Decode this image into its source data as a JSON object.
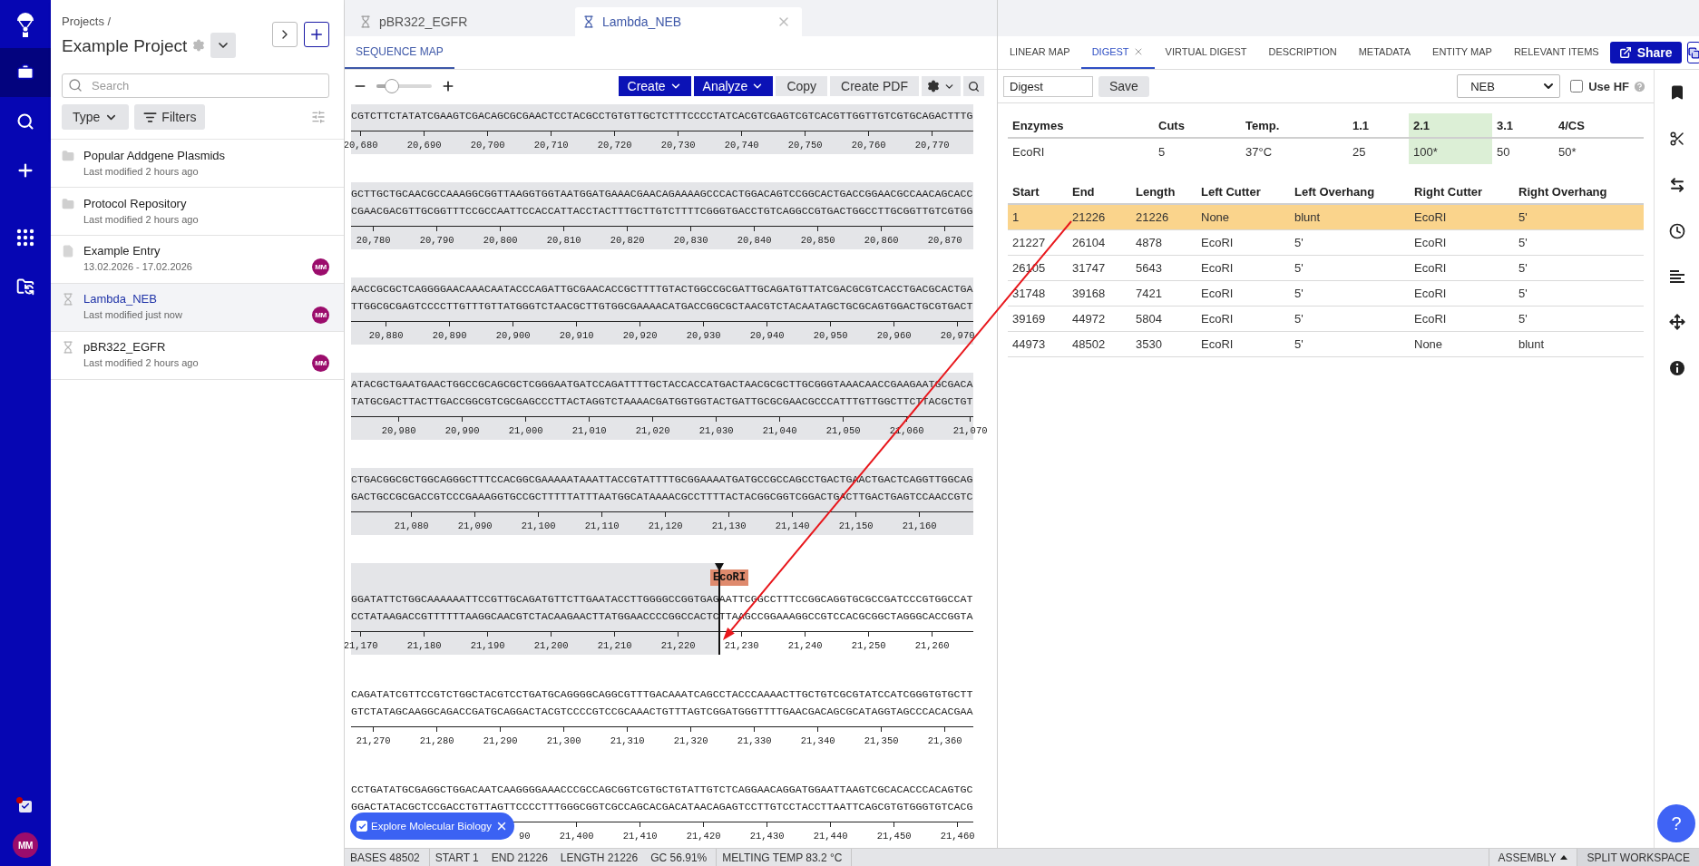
{
  "rail": {
    "items": [
      {
        "selected": true
      },
      {
        "selected": false
      },
      {
        "selected": false
      },
      {
        "selected": false
      },
      {
        "selected": false
      }
    ],
    "tasks": {
      "notification": true
    },
    "avatar": "MM"
  },
  "project_panel": {
    "breadcrumb": "Projects /",
    "title": "Example Project",
    "search": {
      "placeholder": "Search"
    },
    "type_button": "Type",
    "filters_button": "Filters",
    "items": [
      {
        "kind": "folder",
        "title": "Popular Addgene Plasmids",
        "subtitle": "Last modified 2 hours ago",
        "selected": false
      },
      {
        "kind": "folder",
        "title": "Protocol Repository",
        "subtitle": "Last modified 2 hours ago",
        "selected": false
      },
      {
        "kind": "entry",
        "title": "Example Entry",
        "subtitle": "13.02.2026 - 17.02.2026",
        "avatar": "MM",
        "selected": false
      },
      {
        "kind": "sequence",
        "title": "Lambda_NEB",
        "subtitle": "Last modified just now",
        "avatar": "MM",
        "selected": true
      },
      {
        "kind": "sequence",
        "title": "pBR322_EGFR",
        "subtitle": "Last modified 2 hours ago",
        "avatar": "MM",
        "selected": false
      }
    ]
  },
  "editor_tabs": [
    {
      "label": "pBR322_EGFR",
      "selected": false
    },
    {
      "label": "Lambda_NEB",
      "selected": true
    }
  ],
  "sequence_view": {
    "tabs": [
      {
        "label": "SEQUENCE MAP",
        "selected": true
      }
    ],
    "zoom": {
      "level": 0.28
    },
    "toolbar": [
      {
        "kind": "menu",
        "label": "Create"
      },
      {
        "kind": "menu",
        "label": "Analyze"
      },
      {
        "kind": "plain",
        "label": "Copy"
      },
      {
        "kind": "plain",
        "label": "Create PDF"
      },
      {
        "kind": "settings"
      },
      {
        "kind": "search"
      }
    ],
    "blocks": [
      {
        "strands": [
          "CGTCTTCTATATCGAAGTCGACAGCGCGAACTCCTACGCCTGTGTTGCTCTTTCCCCTATCACGTCGAGTCGTCACGTTGGTTGTCGTGCAGACTTTG"
        ],
        "ticks": [
          "20,680",
          "20,690",
          "20,700",
          "20,710",
          "20,720",
          "20,730",
          "20,740",
          "20,750",
          "20,760",
          "20,770"
        ],
        "selected": true
      },
      {
        "strands": [
          "GCTTGCTGCAACGCCAAAGGCGGTTAAGGTGGTAATGGATGAAACGAACAGAAAAGCCCACTGGACAGTCCGGCACTGACCGGAACGCCAACAGCACC",
          "CGAACGACGTTGCGGTTTCCGCCAATTCCACCATTACCTACTTTGCTTGTCTTTTCGGGTGACCTGTCAGGCCGTGACTGGCCTTGCGGTTGTCGTGG"
        ],
        "ticks": [
          "20,780",
          "20,790",
          "20,800",
          "20,810",
          "20,820",
          "20,830",
          "20,840",
          "20,850",
          "20,860",
          "20,870"
        ],
        "selected": true
      },
      {
        "strands": [
          "AACCGCGCTCAGGGGAACAAACAATACCCAGATTGCGAACACCGCTTTTGTACTGGCCGCGATTGCAGATGTTATCGACGCGTCACCTGACGCACTGA",
          "TTGGCGCGAGTCCCCTTGTTTGTTATGGGTCTAACGCTTGTGGCGAAAACATGACCGGCGCTAACGTCTACAATAGCTGCGCAGTGGACTGCGTGACT"
        ],
        "ticks": [
          "20,880",
          "20,890",
          "20,900",
          "20,910",
          "20,920",
          "20,930",
          "20,940",
          "20,950",
          "20,960",
          "20,970"
        ],
        "selected": true
      },
      {
        "strands": [
          "ATACGCTGAATGAACTGGCCGCAGCGCTCGGGAATGATCCAGATTTTGCTACCACCATGACTAACGCGCTTGCGGGTAAACAACCGAAGAATGCGACA",
          "TATGCGACTTACTTGACCGGCGTCGCGAGCCCTTACTAGGTCTAAAACGATGGTGGTACTGATTGCGCGAACGCCCATTTGTTGGCTTCTTACGCTGT"
        ],
        "ticks": [
          "20,980",
          "20,990",
          "21,000",
          "21,010",
          "21,020",
          "21,030",
          "21,040",
          "21,050",
          "21,060",
          "21,070"
        ],
        "selected": true
      },
      {
        "strands": [
          "CTGACGGCGCTGGCAGGGCTTTCCACGGCGAAAAATAAATTACCGTATTTTGCGGAAAATGATGCCGCCAGCCTGACTGAACTGACTCAGGTTGGCAG",
          "GACTGCCGCGACCGTCCCGAAAGGTGCCGCTTTTTATTTAATGGCATAAAACGCCTTTTACTACGGCGGTCGGACTGACTTGACTGAGTCCAACCGTC"
        ],
        "ticks": [
          "21,080",
          "21,090",
          "21,100",
          "21,110",
          "21,120",
          "21,130",
          "21,140",
          "21,150",
          "21,160"
        ],
        "selected": true
      },
      {
        "strands": [
          "GGATATTCTGGCAAAAAATTCCGTTGCAGATGTTCTTGAATACCTTGGGGCCGGTGAGAATTCGGCCTTTCCGGCAGGTGCGCCGATCCCGTGGCCAT",
          "CCTATAAGACCGTTTTTTAAGGCAACGTCTACAAGAACTTATGGAACCCCGGCCACTCTTAAGCCGGAAAGGCCGTCCACGCGGCTAGGGCACCGGTA"
        ],
        "ticks": [
          "21,170",
          "21,180",
          "21,190",
          "21,200",
          "21,210",
          "21,220",
          "21,230",
          "21,240",
          "21,250",
          "21,260"
        ],
        "selected": true,
        "cut": {
          "label": "EcoRI"
        }
      },
      {
        "strands": [
          "CAGATATCGTTCCGTCTGGCTACGTCCTGATGCAGGGGCAGGCGTTTGACAAATCAGCCTACCCAAAACTTGCTGTCGCGTATCCATCGGGTGTGCTT",
          "GTCTATAGCAAGGCAGACCGATGCAGGACTACGTCCCCGTCCGCAAACTGTTTAGTCGGATGGGTTTTGAACGACAGCGCATAGGTAGCCCACACGAA"
        ],
        "ticks": [
          "21,270",
          "21,280",
          "21,290",
          "21,300",
          "21,310",
          "21,320",
          "21,330",
          "21,340",
          "21,350",
          "21,360"
        ],
        "selected": false
      },
      {
        "strands": [
          "CCTGATATGCGAGGCTGGACAATCAAGGGGAAACCCGCCAGCGGTCGTGCTGTATTGTCTCAGGAACAGGATGGAATTAAGTCGCACACCCACAGTGC",
          "GGACTATACGCTCCGACCTGTTAGTTCCCCTTTGGGCGGTCGCCAGCACGACATAACAGAGTCCTTGTCCTACCTTAATTCAGCGTGTGGGTGTCACG"
        ],
        "ticks": [
          "90",
          "21,400",
          "21,410",
          "21,420",
          "21,430",
          "21,440",
          "21,450",
          "21,460"
        ],
        "selected": false
      }
    ],
    "chip": {
      "label": "Explore Molecular Biology",
      "checked": true
    }
  },
  "detail_tabs": [
    {
      "label": "LINEAR MAP",
      "selected": false,
      "closable": false
    },
    {
      "label": "DIGEST",
      "selected": true,
      "closable": true
    },
    {
      "label": "VIRTUAL DIGEST",
      "selected": false,
      "closable": false
    },
    {
      "label": "DESCRIPTION",
      "selected": false,
      "closable": false
    },
    {
      "label": "METADATA",
      "selected": false,
      "closable": false
    },
    {
      "label": "ENTITY MAP",
      "selected": false,
      "closable": false
    },
    {
      "label": "RELEVANT ITEMS",
      "selected": false,
      "closable": false
    }
  ],
  "share_button": "Share",
  "digest": {
    "name_field": {
      "value": "Digest"
    },
    "save_button": "Save",
    "vendor_select": {
      "value": "NEB"
    },
    "use_hf": {
      "label": "Use HF",
      "checked": false
    },
    "enzymes": {
      "columns": [
        {
          "label": "Enzymes",
          "highlighted": false
        },
        {
          "label": "Cuts",
          "highlighted": false
        },
        {
          "label": "Temp.",
          "highlighted": false
        },
        {
          "label": "1.1",
          "highlighted": false
        },
        {
          "label": "2.1",
          "highlighted": true
        },
        {
          "label": "3.1",
          "highlighted": false
        },
        {
          "label": "4/CS",
          "highlighted": false
        }
      ],
      "rows": [
        [
          "EcoRI",
          "5",
          "37°C",
          "25",
          "100*",
          "50",
          "50*"
        ]
      ]
    },
    "fragments": {
      "columns": [
        "Start",
        "End",
        "Length",
        "Left Cutter",
        "Left Overhang",
        "Right Cutter",
        "Right Overhang"
      ],
      "rows": [
        {
          "cells": [
            "1",
            "21226",
            "21226",
            "None",
            "blunt",
            "EcoRI",
            "5'"
          ],
          "selected": true
        },
        {
          "cells": [
            "21227",
            "26104",
            "4878",
            "EcoRI",
            "5'",
            "EcoRI",
            "5'"
          ],
          "selected": false
        },
        {
          "cells": [
            "26105",
            "31747",
            "5643",
            "EcoRI",
            "5'",
            "EcoRI",
            "5'"
          ],
          "selected": false
        },
        {
          "cells": [
            "31748",
            "39168",
            "7421",
            "EcoRI",
            "5'",
            "EcoRI",
            "5'"
          ],
          "selected": false
        },
        {
          "cells": [
            "39169",
            "44972",
            "5804",
            "EcoRI",
            "5'",
            "EcoRI",
            "5'"
          ],
          "selected": false
        },
        {
          "cells": [
            "44973",
            "48502",
            "3530",
            "EcoRI",
            "5'",
            "None",
            "blunt"
          ],
          "selected": false
        }
      ]
    }
  },
  "status_bar": {
    "groups": [
      [
        "BASES 48502"
      ],
      [
        "START 1",
        "END 21226",
        "LENGTH 21226",
        "GC 56.91%"
      ],
      [
        "MELTING TEMP 83.2 °C"
      ]
    ],
    "buttons": [
      {
        "kind": "menu",
        "label": "ASSEMBLY"
      },
      {
        "kind": "plain",
        "label": "SPLIT WORKSPACE"
      }
    ]
  },
  "help_button": "?"
}
